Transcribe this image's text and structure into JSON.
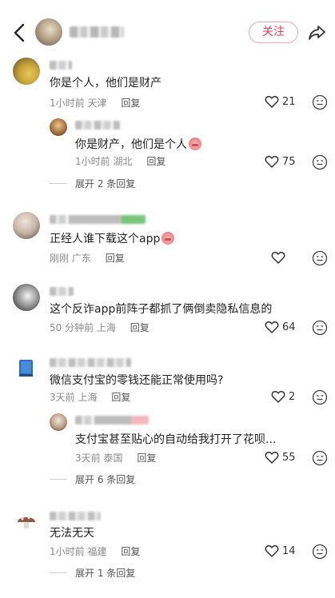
{
  "header": {
    "follow_label": "关注"
  },
  "comments": [
    {
      "text": "你是个人，他们是财产",
      "time": "1小时前",
      "location": "天津",
      "reply_label": "回复",
      "likes": "21",
      "replies": [
        {
          "text": "你是财产，他们是个人",
          "time": "1小时前",
          "location": "湖北",
          "reply_label": "回复",
          "likes": "75"
        }
      ],
      "expand_label": "展开 2 条回复"
    },
    {
      "text": "正经人谁下载这个app",
      "time": "刚刚",
      "location": "广东",
      "reply_label": "回复",
      "likes": ""
    },
    {
      "text": "这个反诈app前阵子都抓了俩倒卖隐私信息的",
      "time": "50 分钟前",
      "location": "上海",
      "reply_label": "回复",
      "likes": "64"
    },
    {
      "text": "微信支付宝的零钱还能正常使用吗?",
      "time": "3天前",
      "location": "上海",
      "reply_label": "回复",
      "likes": "2",
      "replies": [
        {
          "text": "支付宝甚至贴心的自动给我打开了花呗...",
          "time": "3天前",
          "location": "泰国",
          "reply_label": "回复",
          "likes": "55"
        }
      ],
      "expand_label": "展开 6 条回复"
    },
    {
      "text": "无法无天",
      "time": "1小时前",
      "location": "福建",
      "reply_label": "回复",
      "likes": "14",
      "expand_label": "展开 1 条回复"
    }
  ]
}
